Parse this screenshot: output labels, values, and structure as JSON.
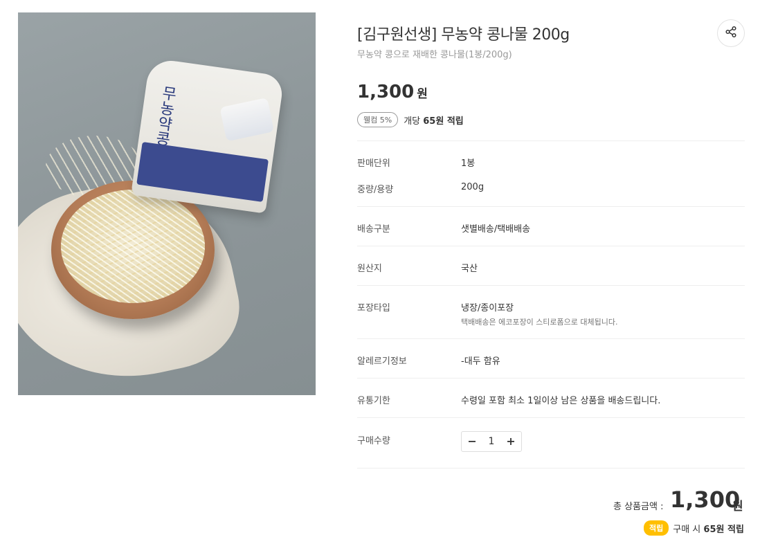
{
  "product": {
    "title": "[김구원선생] 무농약 콩나물 200g",
    "subtitle": "무농약 콩으로 재배한 콩나물(1봉/200g)",
    "price": "1,300",
    "price_unit": "원",
    "image_alt": "무농약 콩나물",
    "bag_text": "무농약콩나물"
  },
  "benefit": {
    "badge": "웰컴 5%",
    "prefix": "개당",
    "amount": "65원 적립"
  },
  "info": [
    {
      "label": "판매단위",
      "value": "1봉"
    },
    {
      "label": "중량/용량",
      "value": "200g"
    },
    {
      "label": "배송구분",
      "value": "샛별배송/택배배송"
    },
    {
      "label": "원산지",
      "value": "국산"
    },
    {
      "label": "포장타입",
      "value": "냉장/종이포장",
      "note": "택배배송은 에코포장이 스티로폼으로 대체됩니다."
    },
    {
      "label": "알레르기정보",
      "value": "-대두 함유"
    },
    {
      "label": "유통기한",
      "value": "수령일 포함 최소 1일이상 남은 상품을 배송드립니다."
    },
    {
      "label": "구매수량"
    }
  ],
  "quantity": {
    "value": "1",
    "minus": "−",
    "plus": "+"
  },
  "total": {
    "label": "총 상품금액 :",
    "price": "1,300",
    "unit": "원"
  },
  "points": {
    "badge": "적립",
    "prefix": "구매 시",
    "amount": "65원 적립"
  },
  "icons": {
    "share": "share-icon",
    "minus": "minus-icon",
    "plus": "plus-icon"
  }
}
